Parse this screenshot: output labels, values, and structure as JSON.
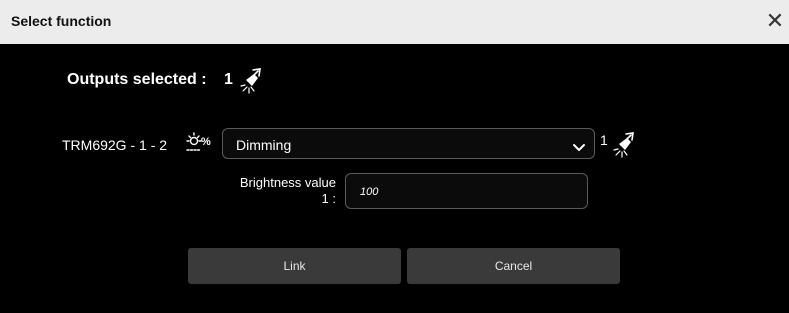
{
  "dialog": {
    "title": "Select function",
    "close_icon": "close-icon"
  },
  "outputs": {
    "label": "Outputs selected :",
    "count": "1",
    "icon": "selected-lamp-icon"
  },
  "row": {
    "device_label": "TRM692G - 1 - 2",
    "device_icon": "dimmer-percent-icon",
    "function_select": {
      "value": "Dimming",
      "chevron": "chevron-down-icon"
    },
    "selected_count": "1",
    "selected_icon": "selected-lamp-icon"
  },
  "brightness": {
    "label_line1": "Brightness value",
    "label_line2": "1 :",
    "value": "100"
  },
  "buttons": {
    "link": "Link",
    "cancel": "Cancel"
  },
  "colors": {
    "background": "#000000",
    "titlebar": "#ececec",
    "button": "#3a3a3a",
    "field_border": "#5a5a5a"
  }
}
